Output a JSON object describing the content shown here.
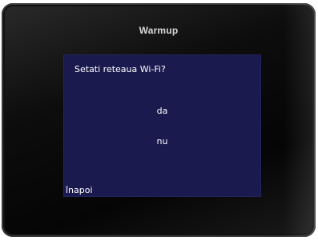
{
  "device": {
    "brand": "Warmup"
  },
  "screen": {
    "title": "Setati reteaua Wi-Fi?",
    "options": [
      {
        "label": "da"
      },
      {
        "label": "nu"
      }
    ],
    "back_label": "înapoi"
  },
  "colors": {
    "screen_background": "#1a1a4f",
    "bezel": "#0d0d0d",
    "text": "#ffffff"
  }
}
